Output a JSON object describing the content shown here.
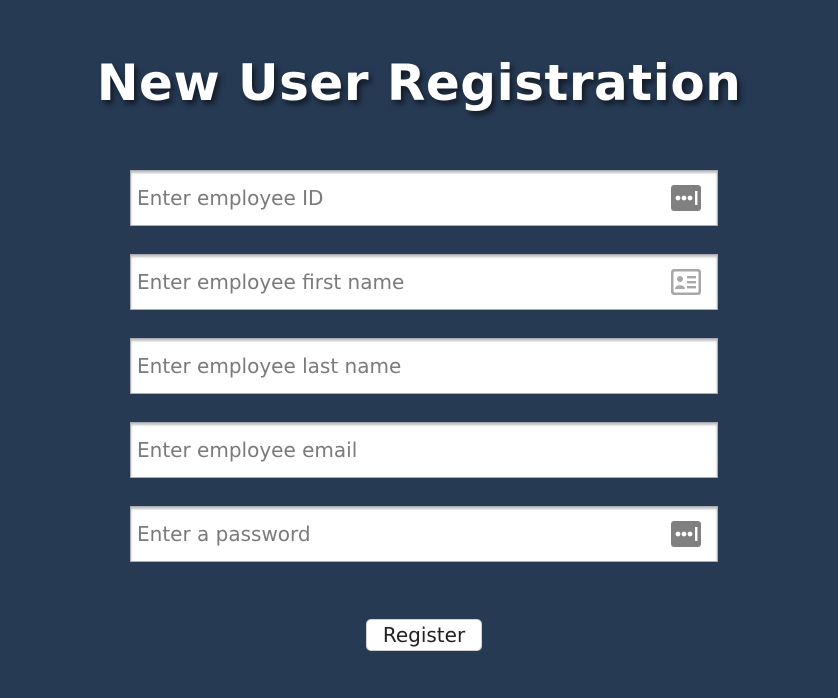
{
  "page": {
    "title": "New User Registration",
    "background_color": "#263a54"
  },
  "form": {
    "fields": [
      {
        "placeholder": "Enter employee ID",
        "value": "",
        "icon": "password-dots-icon"
      },
      {
        "placeholder": "Enter employee first name",
        "value": "",
        "icon": "contact-card-icon"
      },
      {
        "placeholder": "Enter employee last name",
        "value": "",
        "icon": ""
      },
      {
        "placeholder": "Enter employee email",
        "value": "",
        "icon": ""
      },
      {
        "placeholder": "Enter a password",
        "value": "",
        "icon": "password-dots-icon"
      }
    ],
    "register_label": "Register"
  }
}
